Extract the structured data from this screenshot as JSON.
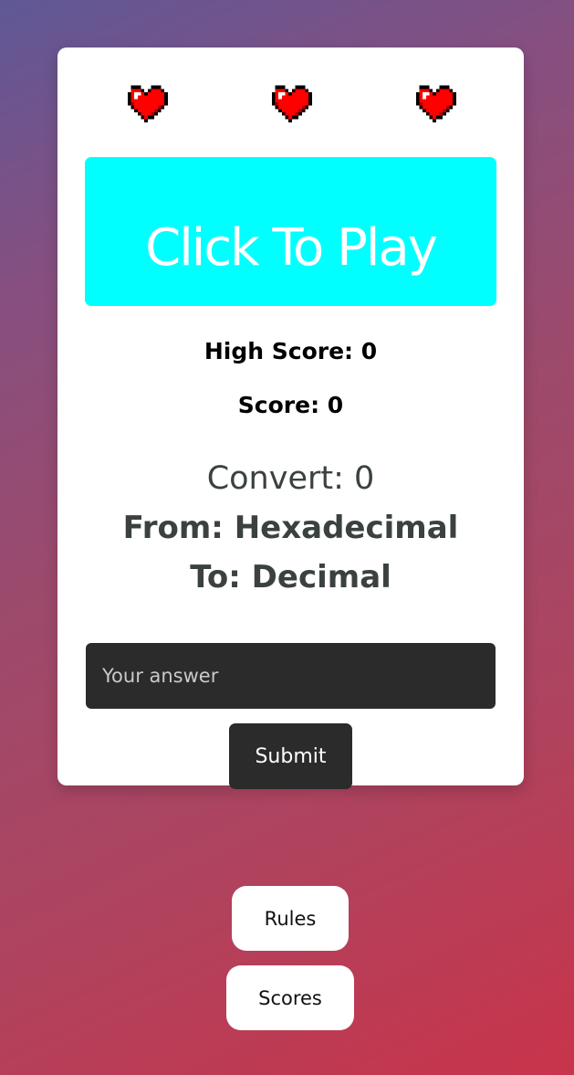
{
  "lives": {
    "hearts": [
      "heart-icon",
      "heart-icon",
      "heart-icon"
    ],
    "heart_color": "#ff0000"
  },
  "play_button": {
    "label": "Click To Play",
    "color": "#00ffff"
  },
  "stats": {
    "high_score_label": "High Score: 0",
    "score_label": "Score: 0"
  },
  "question": {
    "convert_label": "Convert: 0",
    "from_label": "From: Hexadecimal",
    "to_label": "To: Decimal"
  },
  "answer": {
    "placeholder": "Your answer",
    "value": ""
  },
  "submit": {
    "label": "Submit"
  },
  "footer": {
    "rules_label": "Rules",
    "scores_label": "Scores"
  },
  "colors": {
    "dark_control": "#2b2b2b",
    "card": "#ffffff"
  }
}
